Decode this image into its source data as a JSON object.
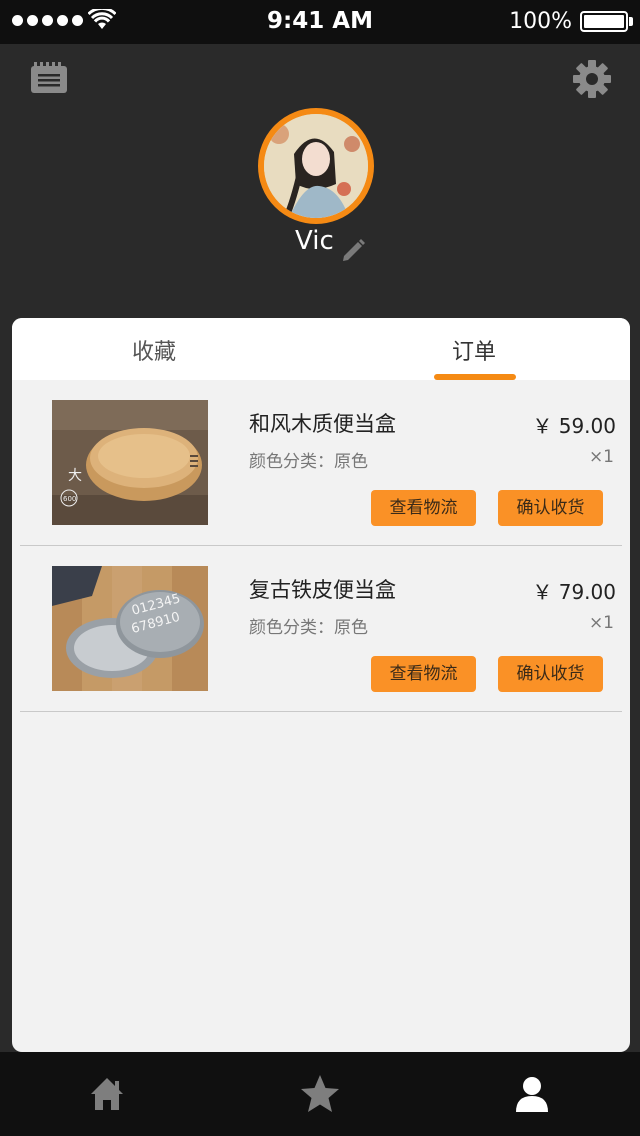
{
  "status_bar": {
    "time": "9:41 AM",
    "battery": "100%"
  },
  "profile": {
    "username": "Vic",
    "avatar_ring_color": "#f58a14"
  },
  "tabs": [
    {
      "label": "收藏",
      "active": false
    },
    {
      "label": "订单",
      "active": true
    }
  ],
  "orders": [
    {
      "name": "和风木质便当盒",
      "price": "￥ 59.00",
      "spec": "颜色分类：原色",
      "qty": "×1",
      "track_label": "查看物流",
      "confirm_label": "确认收货",
      "thumb_text": "大",
      "thumb_sub": "600"
    },
    {
      "name": "复古铁皮便当盒",
      "price": "￥ 79.00",
      "spec": "颜色分类：原色",
      "qty": "×1",
      "track_label": "查看物流",
      "confirm_label": "确认收货",
      "thumb_text": "012345",
      "thumb_sub": "678910"
    }
  ],
  "bottom_tabs": [
    {
      "icon": "home-icon",
      "active": false
    },
    {
      "icon": "star-icon",
      "active": false
    },
    {
      "icon": "user-icon",
      "active": true
    }
  ],
  "colors": {
    "accent": "#f58a14",
    "button": "#fa9126",
    "background": "#2a2a2a"
  }
}
